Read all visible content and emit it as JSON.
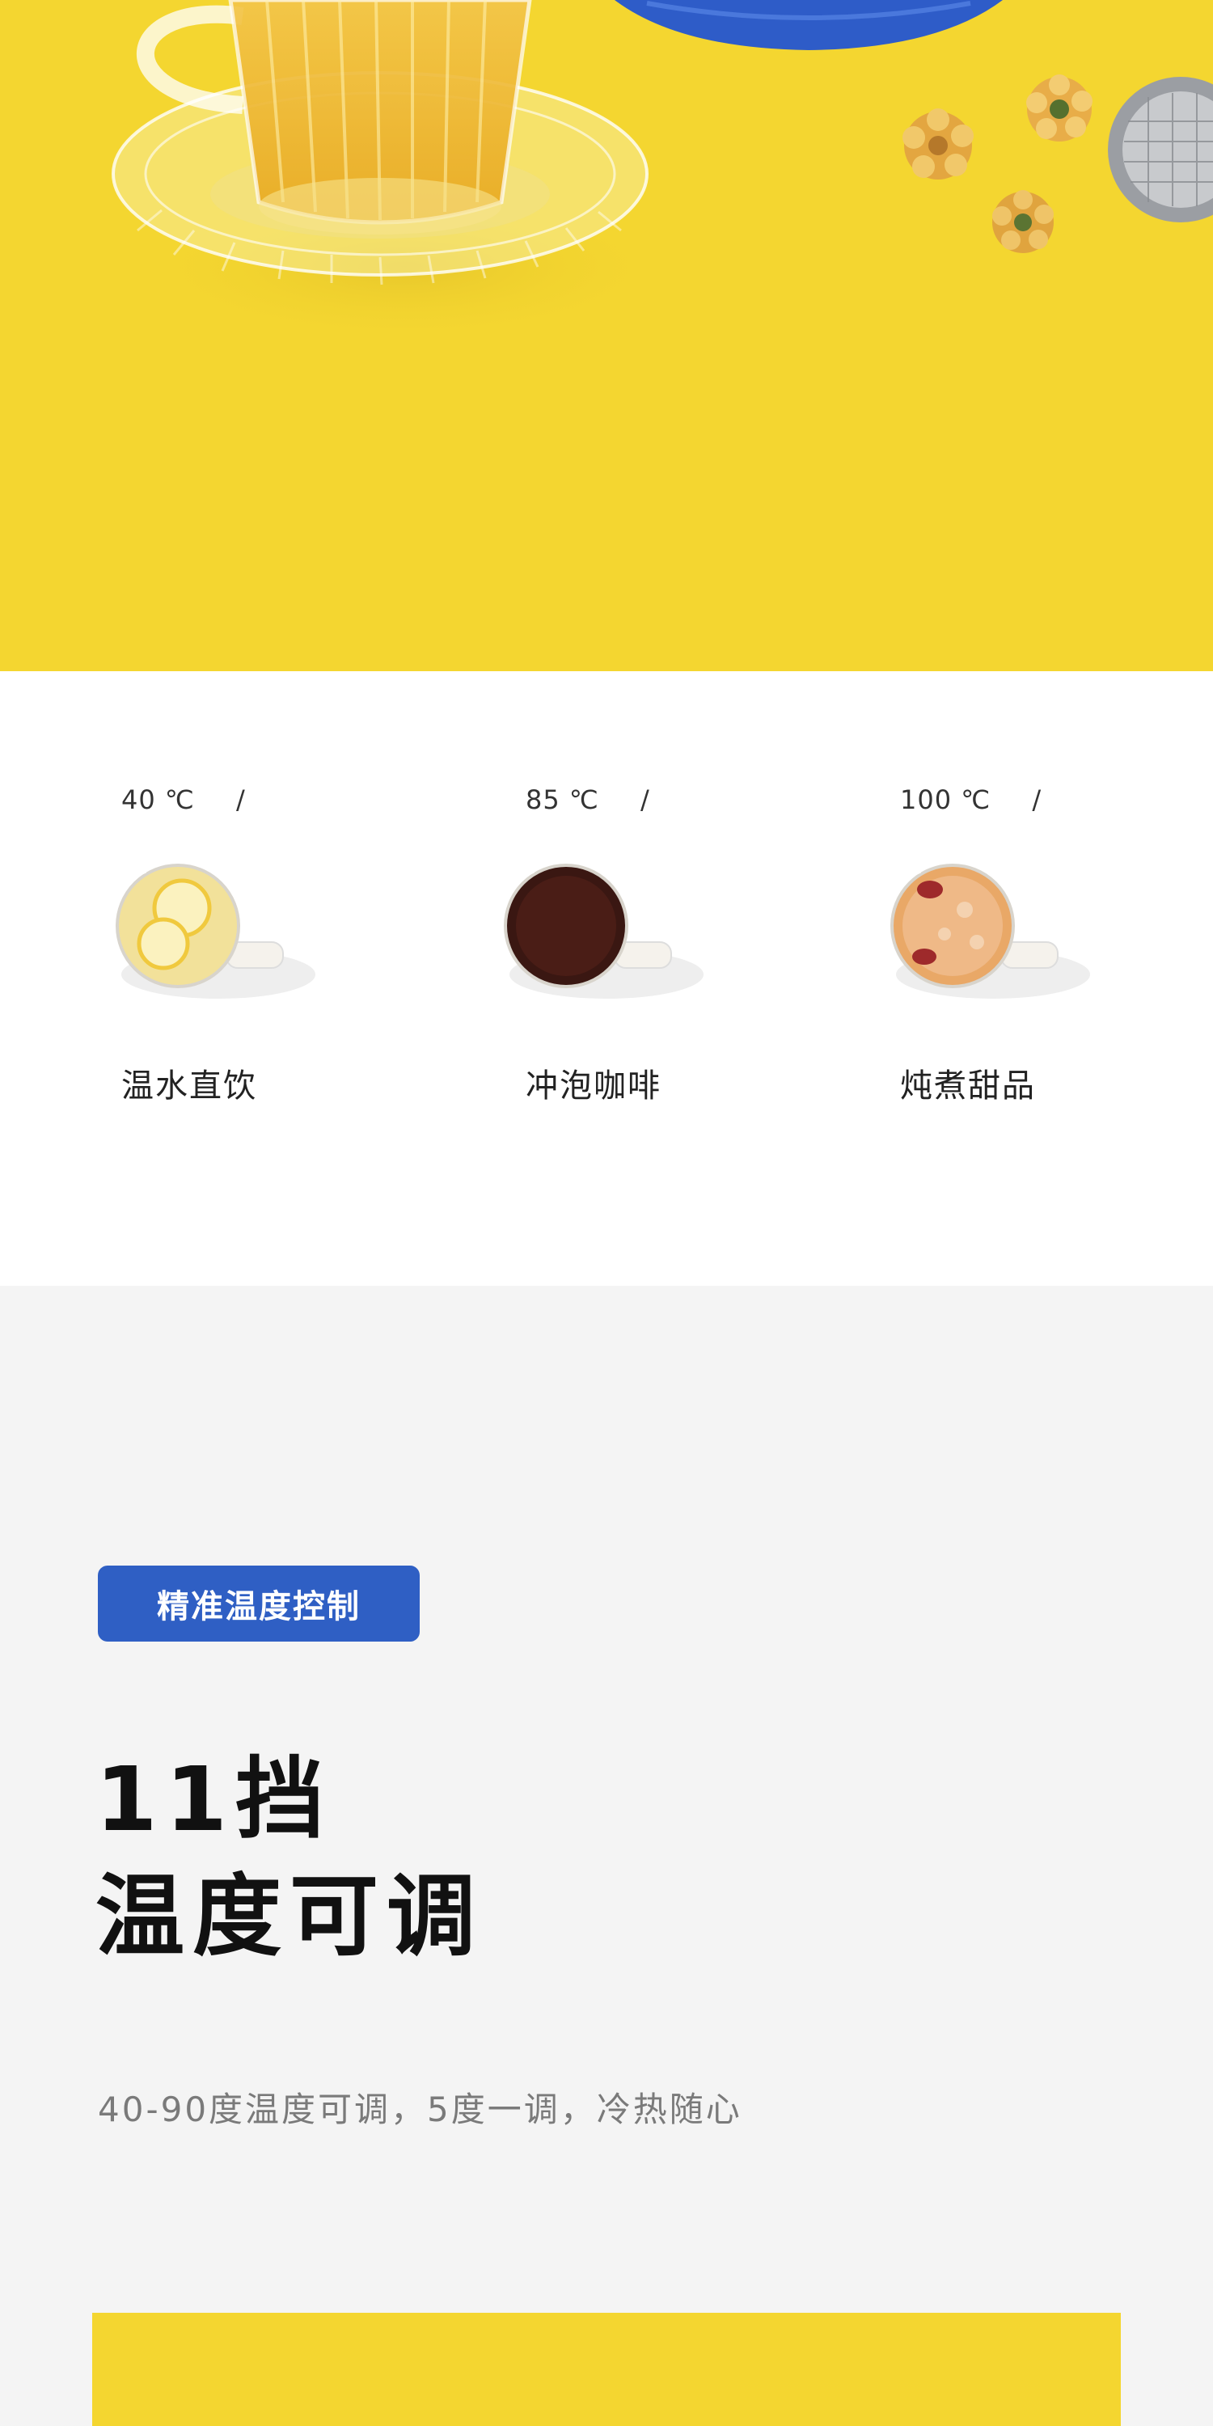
{
  "hero": {
    "background_color": "#f4d630",
    "icons": [
      "glass-tea-cup-icon",
      "glass-saucer-icon",
      "blue-kettle-icon",
      "dried-chrysanthemum-icon",
      "tea-infuser-ball-icon"
    ]
  },
  "presets": [
    {
      "temp_value": "40",
      "temp_unit": "℃",
      "separator": "/",
      "name": "温水直饮",
      "icon": "lemon-water-jug-icon",
      "liquid_color": "#f2e19a"
    },
    {
      "temp_value": "85",
      "temp_unit": "℃",
      "separator": "/",
      "name": "冲泡咖啡",
      "icon": "coffee-jug-icon",
      "liquid_color": "#3a1712"
    },
    {
      "temp_value": "100",
      "temp_unit": "℃",
      "separator": "/",
      "name": "炖煮甜品",
      "icon": "dessert-soup-jug-icon",
      "liquid_color": "#e9a867"
    }
  ],
  "feature": {
    "badge": "精准温度控制",
    "headline_line1": "11挡",
    "headline_line2": "温度可调",
    "description": "40-90度温度可调，5度一调，冷热随心",
    "accent_color": "#2f5fc4",
    "panel_color": "#f4d630"
  }
}
